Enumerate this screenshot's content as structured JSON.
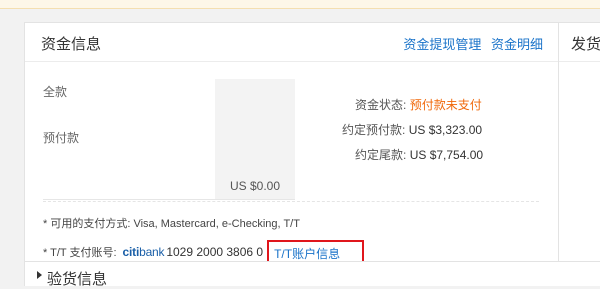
{
  "funds": {
    "title": "资金信息",
    "links": [
      "资金提现管理",
      "资金明细"
    ],
    "amounts": {
      "total_label": "全款",
      "prepay_label": "预付款",
      "value": "US $0.00"
    },
    "status": {
      "label": "资金状态:",
      "value": "预付款未支付"
    },
    "agreed_prepay": {
      "label": "约定预付款:",
      "value": "US $3,323.00"
    },
    "agreed_balance": {
      "label": "约定尾款:",
      "value": "US $7,754.00"
    },
    "notes": {
      "payment_methods": "* 可用的支付方式: Visa, Mastercard, e-Checking, T/T",
      "tt_account_label": "* T/T 支付账号:",
      "bank_logo_citi": "citi",
      "bank_logo_bank": "bank",
      "account_number": "1029 2000 3806 0",
      "tt_account_link": "T/T账户信息"
    }
  },
  "shipping": {
    "title": "发货"
  },
  "inspection": {
    "title": "验货信息"
  },
  "colors": {
    "link": "#1a73c9",
    "warning": "#f0680a",
    "highlight_box": "#e0161c",
    "citi": "#1a5fa8"
  }
}
